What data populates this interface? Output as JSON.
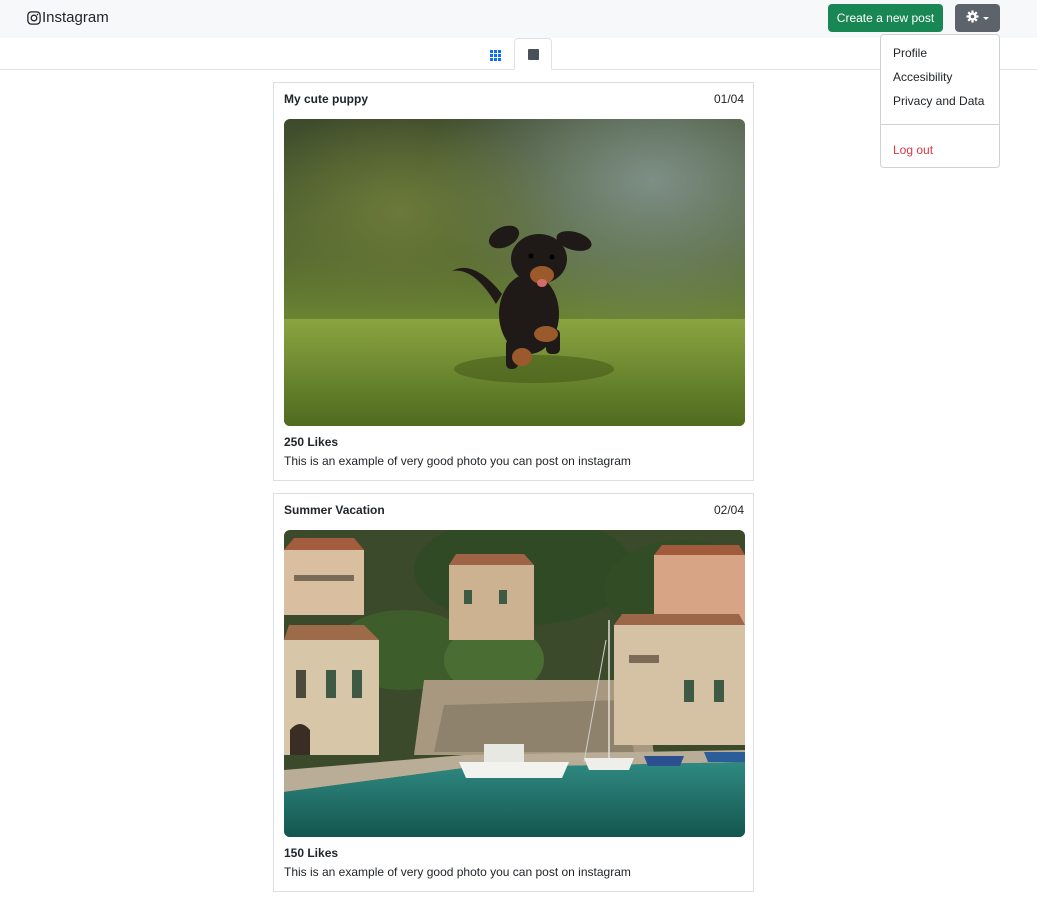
{
  "navbar": {
    "brand": "Instagram",
    "create_label": "Create a new post"
  },
  "menu": {
    "items": [
      "Profile",
      "Accesibility",
      "Privacy and Data"
    ],
    "logout": "Log out",
    "logout_color": "#dc3545"
  },
  "tabs": [
    {
      "icon": "grid-icon",
      "active": false
    },
    {
      "icon": "square-icon",
      "active": true
    }
  ],
  "posts": [
    {
      "title": "My cute puppy",
      "index": "01/04",
      "image": "running-puppy-photo",
      "likes": "250 Likes",
      "caption": "This is an example of very good photo you can post on instagram"
    },
    {
      "title": "Summer Vacation",
      "index": "02/04",
      "image": "harbor-village-photo",
      "likes": "150 Likes",
      "caption": "This is an example of very good photo you can post on instagram"
    }
  ],
  "colors": {
    "create_button": "#198754",
    "settings_button": "#5c636a",
    "accent_grid_icon": "#0d6efd"
  }
}
